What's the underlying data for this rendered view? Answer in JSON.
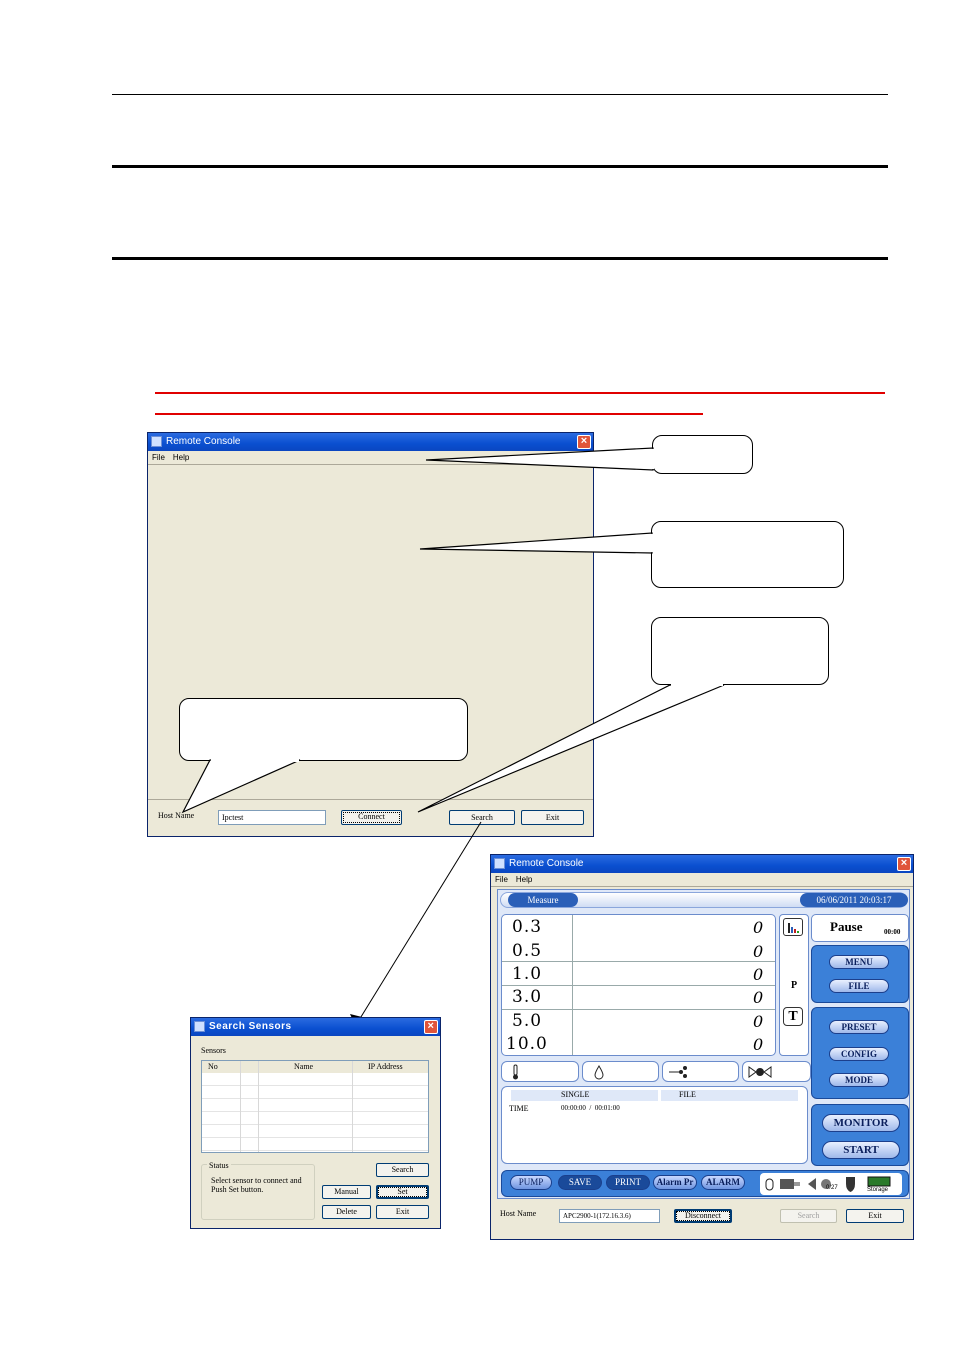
{
  "win1": {
    "title": "Remote Console",
    "menu": [
      "File",
      "Help"
    ],
    "host_label": "Host Name",
    "host_value": "Ipctest",
    "connect_label": "Connect",
    "search_label": "Search",
    "exit_label": "Exit"
  },
  "win2": {
    "title": "Search Sensors",
    "group_label": "Sensors",
    "columns": [
      "No",
      "",
      "Name",
      "IP Address"
    ],
    "status_label": "Status",
    "status_text": "Select sensor to connect and Push Set button.",
    "search_label": "Search",
    "manual_label": "Manual",
    "set_label": "Set",
    "delete_label": "Delete",
    "exit_label": "Exit"
  },
  "win3": {
    "title": "Remote Console",
    "menu": [
      "File",
      "Help"
    ],
    "tab_label": "Measure",
    "datetime": "06/06/2011 20:03:17",
    "sizes": [
      "0.3",
      "0.5",
      "1.0",
      "3.0",
      "5.0",
      "10.0"
    ],
    "counts": [
      "0",
      "0",
      "0",
      "0",
      "0",
      "0"
    ],
    "p_label": "P",
    "t_label": "T",
    "state": "Pause",
    "timer": "00:00",
    "menu_btn": "MENU",
    "file_btn": "FILE",
    "preset_btn": "PRESET",
    "config_btn": "CONFIG",
    "mode_btn": "MODE",
    "monitor_btn": "MONITOR",
    "start_btn": "START",
    "single_label": "SINGLE",
    "file_label": "FILE",
    "time_label": "TIME",
    "time_value": "00:00:00  /  00:01:00",
    "pills": [
      "PUMP",
      "SAVE",
      "PRINT",
      "Alarm Pr",
      "ALARM"
    ],
    "storage_label": "Storage",
    "count_small": "0/27",
    "host_label": "Host Name",
    "host_value": "APC2900-1(172.16.3.6)",
    "disconnect_label": "Disconnect",
    "search_label": "Search",
    "exit_label": "Exit"
  }
}
